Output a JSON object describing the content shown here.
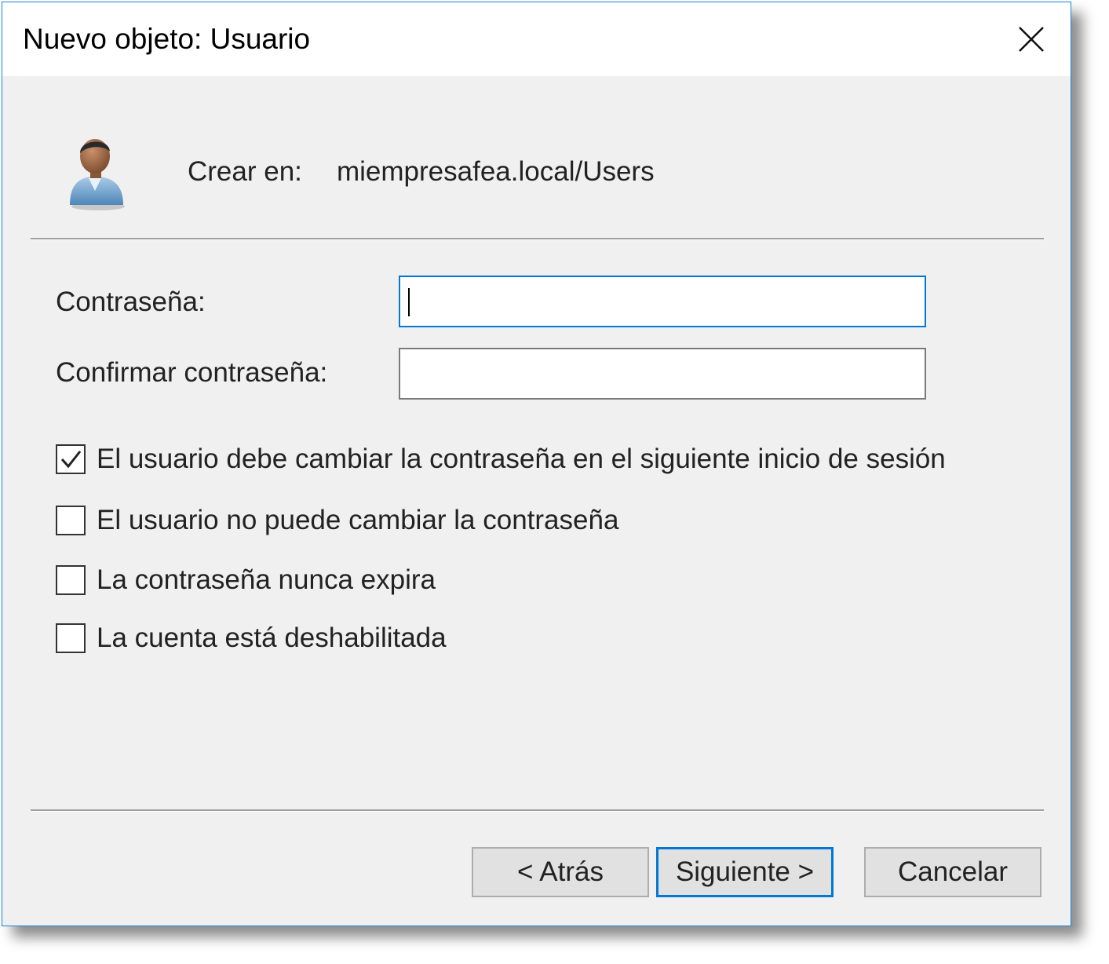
{
  "window": {
    "title": "Nuevo objeto: Usuario"
  },
  "header": {
    "create_label": "Crear en:",
    "create_path": "miempresafea.local/Users"
  },
  "fields": {
    "password_label": "Contraseña:",
    "password_value": "",
    "confirm_label": "Confirmar contraseña:",
    "confirm_value": ""
  },
  "options": [
    {
      "label": "El usuario debe cambiar la contraseña en el siguiente inicio de sesión",
      "checked": true
    },
    {
      "label": "El usuario no puede cambiar la contraseña",
      "checked": false
    },
    {
      "label": "La contraseña nunca expira",
      "checked": false
    },
    {
      "label": "La cuenta está deshabilitada",
      "checked": false
    }
  ],
  "buttons": {
    "back": "< Atrás",
    "next": "Siguiente >",
    "cancel": "Cancelar"
  },
  "colors": {
    "accent": "#0078d7",
    "background": "#f0f0f0"
  },
  "icons": {
    "close": "close-icon",
    "user": "user-icon",
    "check": "check-icon"
  }
}
